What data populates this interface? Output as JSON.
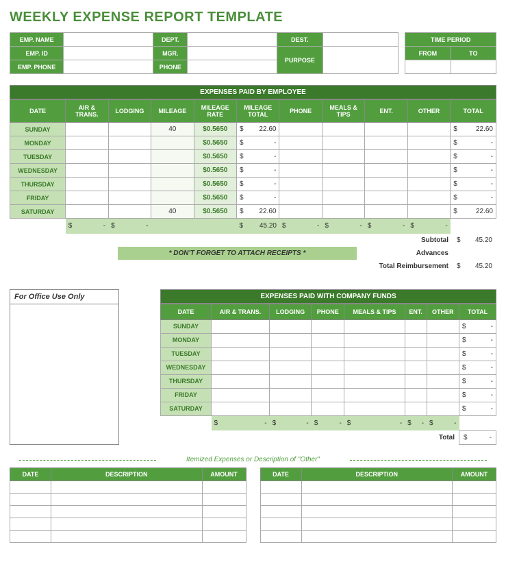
{
  "title": "WEEKLY EXPENSE REPORT TEMPLATE",
  "info": {
    "r1": {
      "emp_name": "EMP. NAME",
      "dept": "DEPT.",
      "dest": "DEST.",
      "time_period": "TIME PERIOD"
    },
    "r2": {
      "emp_id": "EMP. ID",
      "mgr": "MGR.",
      "purpose": "PURPOSE",
      "from": "FROM",
      "to": "TO"
    },
    "r3": {
      "emp_phone": "EMP. PHONE",
      "phone": "PHONE"
    }
  },
  "emp_table": {
    "banner": "EXPENSES PAID BY EMPLOYEE",
    "cols": [
      "DATE",
      "AIR & TRANS.",
      "LODGING",
      "MILEAGE",
      "MILEAGE RATE",
      "MILEAGE TOTAL",
      "PHONE",
      "MEALS & TIPS",
      "ENT.",
      "OTHER",
      "TOTAL"
    ],
    "rows": [
      {
        "day": "SUNDAY",
        "air": "",
        "lodging": "",
        "mileage": "40",
        "rate": "$0.5650",
        "mtotal": "22.60",
        "phone": "",
        "meals": "",
        "ent": "",
        "other": "",
        "total": "22.60"
      },
      {
        "day": "MONDAY",
        "air": "",
        "lodging": "",
        "mileage": "",
        "rate": "$0.5650",
        "mtotal": "-",
        "phone": "",
        "meals": "",
        "ent": "",
        "other": "",
        "total": "-"
      },
      {
        "day": "TUESDAY",
        "air": "",
        "lodging": "",
        "mileage": "",
        "rate": "$0.5650",
        "mtotal": "-",
        "phone": "",
        "meals": "",
        "ent": "",
        "other": "",
        "total": "-"
      },
      {
        "day": "WEDNESDAY",
        "air": "",
        "lodging": "",
        "mileage": "",
        "rate": "$0.5650",
        "mtotal": "-",
        "phone": "",
        "meals": "",
        "ent": "",
        "other": "",
        "total": "-"
      },
      {
        "day": "THURSDAY",
        "air": "",
        "lodging": "",
        "mileage": "",
        "rate": "$0.5650",
        "mtotal": "-",
        "phone": "",
        "meals": "",
        "ent": "",
        "other": "",
        "total": "-"
      },
      {
        "day": "FRIDAY",
        "air": "",
        "lodging": "",
        "mileage": "",
        "rate": "$0.5650",
        "mtotal": "-",
        "phone": "",
        "meals": "",
        "ent": "",
        "other": "",
        "total": "-"
      },
      {
        "day": "SATURDAY",
        "air": "",
        "lodging": "",
        "mileage": "40",
        "rate": "$0.5650",
        "mtotal": "22.60",
        "phone": "",
        "meals": "",
        "ent": "",
        "other": "",
        "total": "22.60"
      }
    ],
    "sums": {
      "air": "-",
      "lodging": "-",
      "mtotal": "45.20",
      "phone": "-",
      "meals": "-",
      "ent": "-",
      "other": "-"
    },
    "receipt_note": "* DON'T FORGET TO ATTACH RECEIPTS *",
    "subtotal_lbl": "Subtotal",
    "subtotal_val": "45.20",
    "advances_lbl": "Advances",
    "reimb_lbl": "Total Reimbursement",
    "reimb_val": "45.20"
  },
  "office_label": "For Office Use Only",
  "funds_table": {
    "banner": "EXPENSES PAID WITH COMPANY FUNDS",
    "cols": [
      "DATE",
      "AIR & TRANS.",
      "LODGING",
      "PHONE",
      "MEALS & TIPS",
      "ENT.",
      "OTHER",
      "TOTAL"
    ],
    "rows": [
      {
        "day": "SUNDAY",
        "total": "-"
      },
      {
        "day": "MONDAY",
        "total": "-"
      },
      {
        "day": "TUESDAY",
        "total": "-"
      },
      {
        "day": "WEDNESDAY",
        "total": "-"
      },
      {
        "day": "THURSDAY",
        "total": "-"
      },
      {
        "day": "FRIDAY",
        "total": "-"
      },
      {
        "day": "SATURDAY",
        "total": "-"
      }
    ],
    "sums": {
      "air": "-",
      "lodging": "-",
      "phone": "-",
      "meals": "-",
      "ent": "-",
      "other": "-"
    },
    "total_lbl": "Total",
    "total_val": "-"
  },
  "itemized": {
    "divider": "Itemized Expenses or Description of \"Other\"",
    "cols": [
      "DATE",
      "DESCRIPTION",
      "AMOUNT"
    ]
  }
}
